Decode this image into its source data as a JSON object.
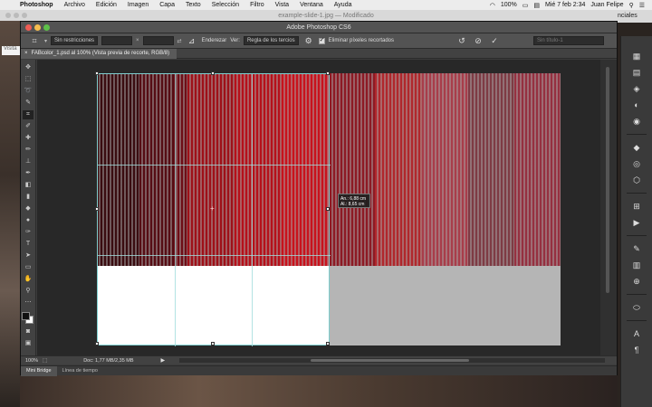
{
  "menubar": {
    "app": "Photoshop",
    "items": [
      "Archivo",
      "Edición",
      "Imagen",
      "Capa",
      "Texto",
      "Selección",
      "Filtro",
      "Vista",
      "Ventana",
      "Ayuda"
    ],
    "battery": "100%",
    "datetime": "Mié 7 feb  2:34",
    "user": "Juan Felipe"
  },
  "background_window": {
    "title": "example-slide-1.jpg — Modificado",
    "left_fragment": "Visita",
    "right_fragment": "nciales"
  },
  "photoshop": {
    "title": "Adobe Photoshop CS6",
    "options": {
      "ratio": "Sin restricciones",
      "swap": "⇄",
      "straighten": "Enderezar",
      "view_label": "Ver:",
      "view": "Regla de los tercios",
      "delete_cropped": "Eliminar píxeles recortados",
      "preset": "Sin título-1"
    },
    "doc_tab": "FABcolor_1.psd al 100% (Vista previa de recorte, RGB/8)",
    "tooltip": {
      "width": "An.: 6,88 cm",
      "height": "Al.: 8,65 cm"
    },
    "status": {
      "zoom": "100%",
      "doc": "Doc: 1,77 MB/2,35 MB"
    },
    "panels": [
      "Mini Bridge",
      "Línea de tiempo"
    ]
  },
  "colors": {
    "accent": "#7fd0d0",
    "stripes": [
      "#3a0c10",
      "#560d14",
      "#6e0d16",
      "#9e1018",
      "#b5101a",
      "#c8121c",
      "#8d1a24",
      "#b0272c",
      "#a83d4a",
      "#7e3b44",
      "#953040"
    ]
  }
}
